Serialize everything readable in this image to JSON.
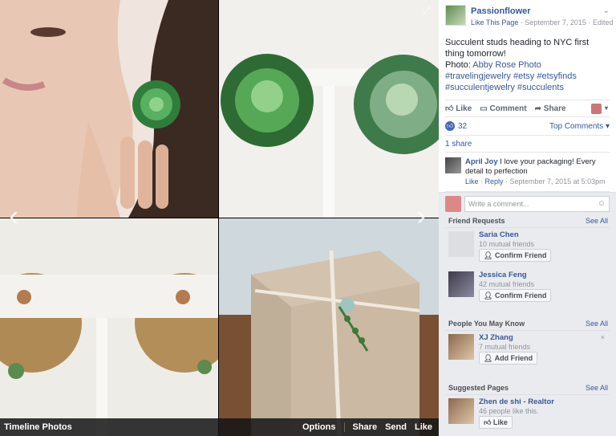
{
  "viewer": {
    "album_label": "Timeline Photos",
    "actions": [
      "Options",
      "Share",
      "Send",
      "Like"
    ],
    "prev_icon": "chevron-left-icon",
    "next_icon": "chevron-right-icon",
    "expand_icon": "expand-icon"
  },
  "post": {
    "page_name": "Passionflower",
    "like_page": "Like This Page",
    "date": "September 7, 2015",
    "edited": "Edited",
    "text_line1": "Succulent studs heading to NYC first thing tomorrow!",
    "photo_prefix": "Photo: ",
    "photo_credit": "Abby Rose Photo",
    "hashtags": "#travelingjewelry #etsy #etsyfinds #succulentjewelry #succulents",
    "action_like": "Like",
    "action_comment": "Comment",
    "action_share": "Share",
    "like_count": "32",
    "top_comments": "Top Comments",
    "shares": "1 share"
  },
  "comment": {
    "author": "April Joy",
    "text": " I love your packaging! Every detail to perfection",
    "like": "Like",
    "reply": "Reply",
    "timestamp": "September 7, 2015 at 5:03pm",
    "placeholder": "Write a comment..."
  },
  "friend_requests": {
    "title": "Friend Requests",
    "see_all": "See All",
    "items": [
      {
        "name": "Saria Chen",
        "mutual": "10 mutual friends",
        "button": "Confirm Friend"
      },
      {
        "name": "Jessica Feng",
        "mutual": "42 mutual friends",
        "button": "Confirm Friend"
      }
    ]
  },
  "people_you_may_know": {
    "title": "People You May Know",
    "see_all": "See All",
    "items": [
      {
        "name": "XJ Zhang",
        "mutual": "7 mutual friends",
        "button": "Add Friend",
        "close": "×"
      }
    ]
  },
  "suggested_pages": {
    "title": "Suggested Pages",
    "see_all": "See All",
    "items": [
      {
        "name": "Zhen de shi - Realtor",
        "likes": "46 people like this.",
        "button": "Like"
      }
    ]
  },
  "colors": {
    "link": "#365899",
    "panel_bg": "#e9ebee",
    "like_blue": "#4267b2"
  }
}
